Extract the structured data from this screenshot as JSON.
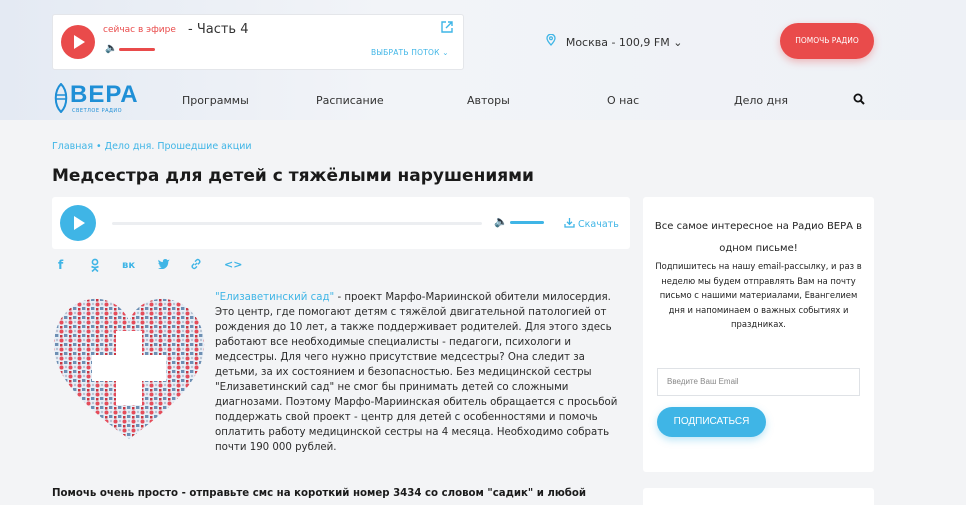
{
  "player": {
    "onair_label": "сейчас в эфире",
    "track_title": "- Часть 4",
    "choose_stream": "ВЫБРАТЬ ПОТОК ⌄"
  },
  "station": {
    "city_freq": "Москва - 100,9 FM ⌄"
  },
  "help_button": "ПОМОЧЬ РАДИО",
  "logo": {
    "name": "ВЕРА",
    "tagline": "СВЕТЛОЕ РАДИО"
  },
  "nav": {
    "items": [
      "Программы",
      "Расписание",
      "Авторы",
      "О нас",
      "Дело дня"
    ]
  },
  "breadcrumb": {
    "home": "Главная",
    "section": "Дело дня. Прошедшие акции"
  },
  "article": {
    "title": "Медсестра для детей с тяжёлыми нарушениями",
    "download": "Скачать",
    "link_text": "\"Елизаветинский сад\"",
    "body": " - проект Марфо-Мариинской обители милосердия. Это центр, где помогают детям с тяжёлой двигательной патологией от рождения до 10 лет, а также поддерживает родителей. Для этого здесь работают все необходимые специалисты - педагоги, психологи и медсестры. Для чего нужно присутствие медсестры? Она следит за детьми, за их состоянием и безопасностью. Без медицинской сестры \"Елизаветинский сад\" не смог бы принимать детей со сложными диагнозами. Поэтому Марфо-Мариинская обитель обращается с просьбой поддержать свой проект - центр для детей с особенностями и помочь оплатить работу медицинской сестры на 4 месяца. Необходимо собрать почти 190 000 рублей.",
    "body2": "Помочь очень просто - отправьте смс на короткий номер 3434 со словом \"садик\" и любой"
  },
  "share": {
    "icons": [
      "facebook-icon",
      "odnoklassniki-icon",
      "vk-icon",
      "twitter-icon",
      "link-icon",
      "embed-icon"
    ]
  },
  "sidebar": {
    "heading": "Все самое интересное на Радио ВЕРА в одном письме!",
    "description": "Подпишитесь на нашу email-рассылку, и раз в неделю мы будем отправлять Вам на почту письмо с нашими материалами, Евангелием дня и напоминаем о важных событиях и праздниках.",
    "email_placeholder": "Введите Ваш Email",
    "subscribe_label": "ПОДПИСАТЬСЯ"
  },
  "colors": {
    "accent_blue": "#3fb5e6",
    "accent_red": "#e94b4b",
    "logo_blue": "#1f8fd6"
  }
}
